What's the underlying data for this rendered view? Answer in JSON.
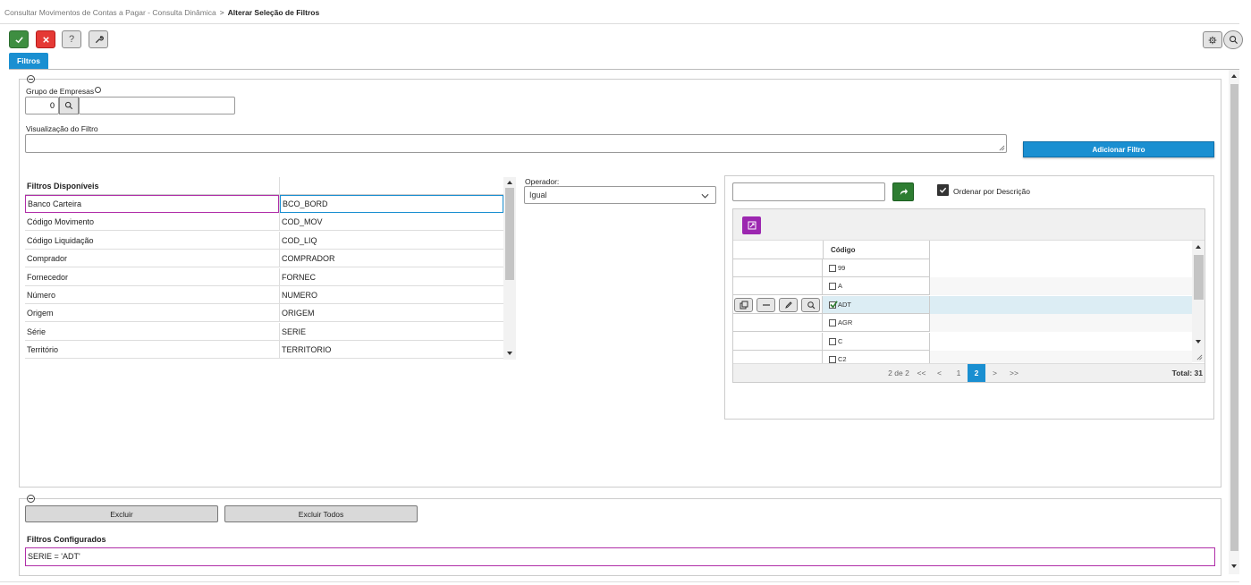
{
  "breadcrumb": {
    "parent": "Consultar Movimentos de Contas a Pagar - Consulta Dinâmica",
    "separator": ">",
    "current": "Alterar Seleção de Filtros"
  },
  "toolbar": {
    "confirm_icon": "check-icon",
    "cancel_icon": "x-icon",
    "help_label": "?",
    "tools_icon": "wrench-icon",
    "settings_icon": "gear-icon",
    "search_icon": "search-icon"
  },
  "tabs": [
    {
      "label": "Filtros",
      "active": true
    }
  ],
  "form": {
    "grupo_label": "Grupo de Empresas",
    "grupo_value": "0",
    "visualizacao_label": "Visualização do Filtro",
    "visualizacao_value": "",
    "adicionar_label": "Adicionar Filtro"
  },
  "filtros_disponiveis": {
    "header": "Filtros Disponíveis",
    "rows": [
      {
        "name": "Banco Carteira",
        "code": "BCO_BORD",
        "selected": true
      },
      {
        "name": "Código Movimento",
        "code": "COD_MOV"
      },
      {
        "name": "Código Liquidação",
        "code": "COD_LIQ"
      },
      {
        "name": "Comprador",
        "code": "COMPRADOR"
      },
      {
        "name": "Fornecedor",
        "code": "FORNEC"
      },
      {
        "name": "Número",
        "code": "NUMERO"
      },
      {
        "name": "Origem",
        "code": "ORIGEM"
      },
      {
        "name": "Série",
        "code": "SERIE"
      },
      {
        "name": "Território",
        "code": "TERRITORIO"
      }
    ]
  },
  "operador": {
    "label": "Operador:",
    "value": "Igual"
  },
  "value_panel": {
    "search_value": "",
    "ordenar_label": "Ordenar por Descrição",
    "ordenar_checked": true,
    "grid_header": "Código",
    "rows": [
      {
        "code": "99",
        "checked": false
      },
      {
        "code": "A",
        "checked": false
      },
      {
        "code": "ADT",
        "checked": true
      },
      {
        "code": "AGR",
        "checked": false
      },
      {
        "code": "C",
        "checked": false
      },
      {
        "code": "C2",
        "checked": false
      }
    ],
    "pagination": {
      "info": "2 de 2",
      "first": "<<",
      "prev": "<",
      "page1": "1",
      "page2": "2",
      "next": ">",
      "last": ">>",
      "total": "Total: 31"
    }
  },
  "bottom": {
    "excluir_label": "Excluir",
    "excluir_todos_label": "Excluir Todos",
    "configurados_header": "Filtros Configurados",
    "configurados_rows": [
      "SERIE = 'ADT'"
    ]
  },
  "colors": {
    "accent": "#1a8fd1",
    "confirm": "#3e8e41",
    "cancel": "#e53935",
    "selected_border": "#b02ea8",
    "highlight_row": "#dcedf4",
    "purple_button": "#9c27b0"
  }
}
